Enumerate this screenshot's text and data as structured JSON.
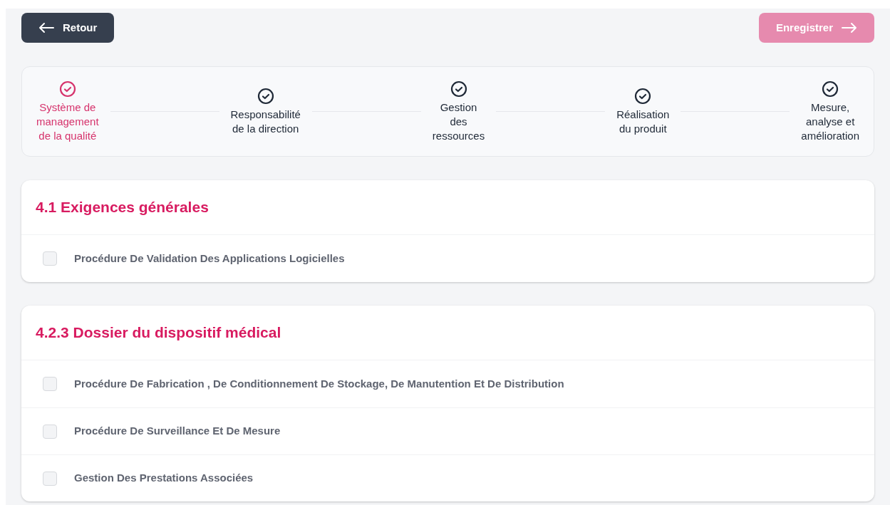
{
  "buttons": {
    "back": {
      "label": "Retour"
    },
    "save": {
      "label": "Enregistrer",
      "disabled": true
    }
  },
  "steps": [
    {
      "label": "Système de\nmanagement\nde la qualité",
      "selected": true
    },
    {
      "label": "Responsabilité\nde la direction",
      "selected": false
    },
    {
      "label": "Gestion\ndes\nressources",
      "selected": false
    },
    {
      "label": "Réalisation\ndu produit",
      "selected": false
    },
    {
      "label": "Mesure,\nanalyse et\namélioration",
      "selected": false
    }
  ],
  "sections": [
    {
      "title": "4.1 Exigences générales",
      "items": [
        {
          "label": "Procédure De Validation Des Applications Logicielles",
          "checked": false
        }
      ]
    },
    {
      "title": "4.2.3 Dossier du dispositif médical",
      "items": [
        {
          "label": "Procédure De Fabrication , De Conditionnement De Stockage, De Manutention Et De Distribution",
          "checked": false
        },
        {
          "label": "Procédure De Surveillance Et De Mesure",
          "checked": false
        },
        {
          "label": "Gestion Des Prestations Associées",
          "checked": false
        }
      ]
    }
  ]
}
